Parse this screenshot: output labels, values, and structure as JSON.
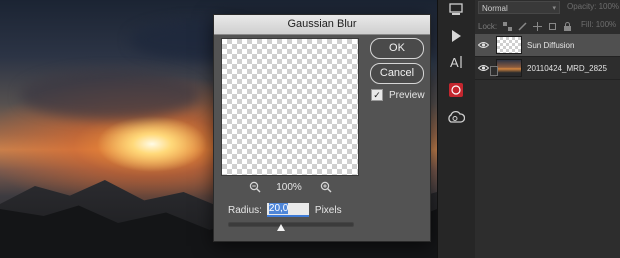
{
  "dialog": {
    "title": "Gaussian Blur",
    "ok_label": "OK",
    "cancel_label": "Cancel",
    "preview_label": "Preview",
    "preview_checked": true,
    "zoom_value": "100%",
    "radius_label": "Radius:",
    "radius_value": "20,0",
    "radius_unit": "Pixels",
    "radius_slider_fraction": 0.43
  },
  "layers_panel": {
    "blend_mode": "Normal",
    "opacity_label": "Opacity:",
    "opacity_value": "100%",
    "lock_label": "Lock:",
    "fill_label": "Fill:",
    "fill_value": "100%",
    "layers": [
      {
        "name": "Sun Diffusion",
        "selected": true,
        "visible": true,
        "thumb": "transparent"
      },
      {
        "name": "20110424_MRD_2825",
        "selected": false,
        "visible": true,
        "thumb": "photo"
      }
    ]
  },
  "toolstrip": {
    "tools": [
      "layers-panel-icon",
      "play-actions-icon",
      "character-panel-icon",
      "adobe-acrobat-icon",
      "creative-cloud-icon"
    ]
  },
  "colors": {
    "dialog_bg": "#535353",
    "selection_blue": "#4f86d8",
    "panel_bg": "#2d2d2d",
    "selected_layer_bg": "#505050"
  }
}
